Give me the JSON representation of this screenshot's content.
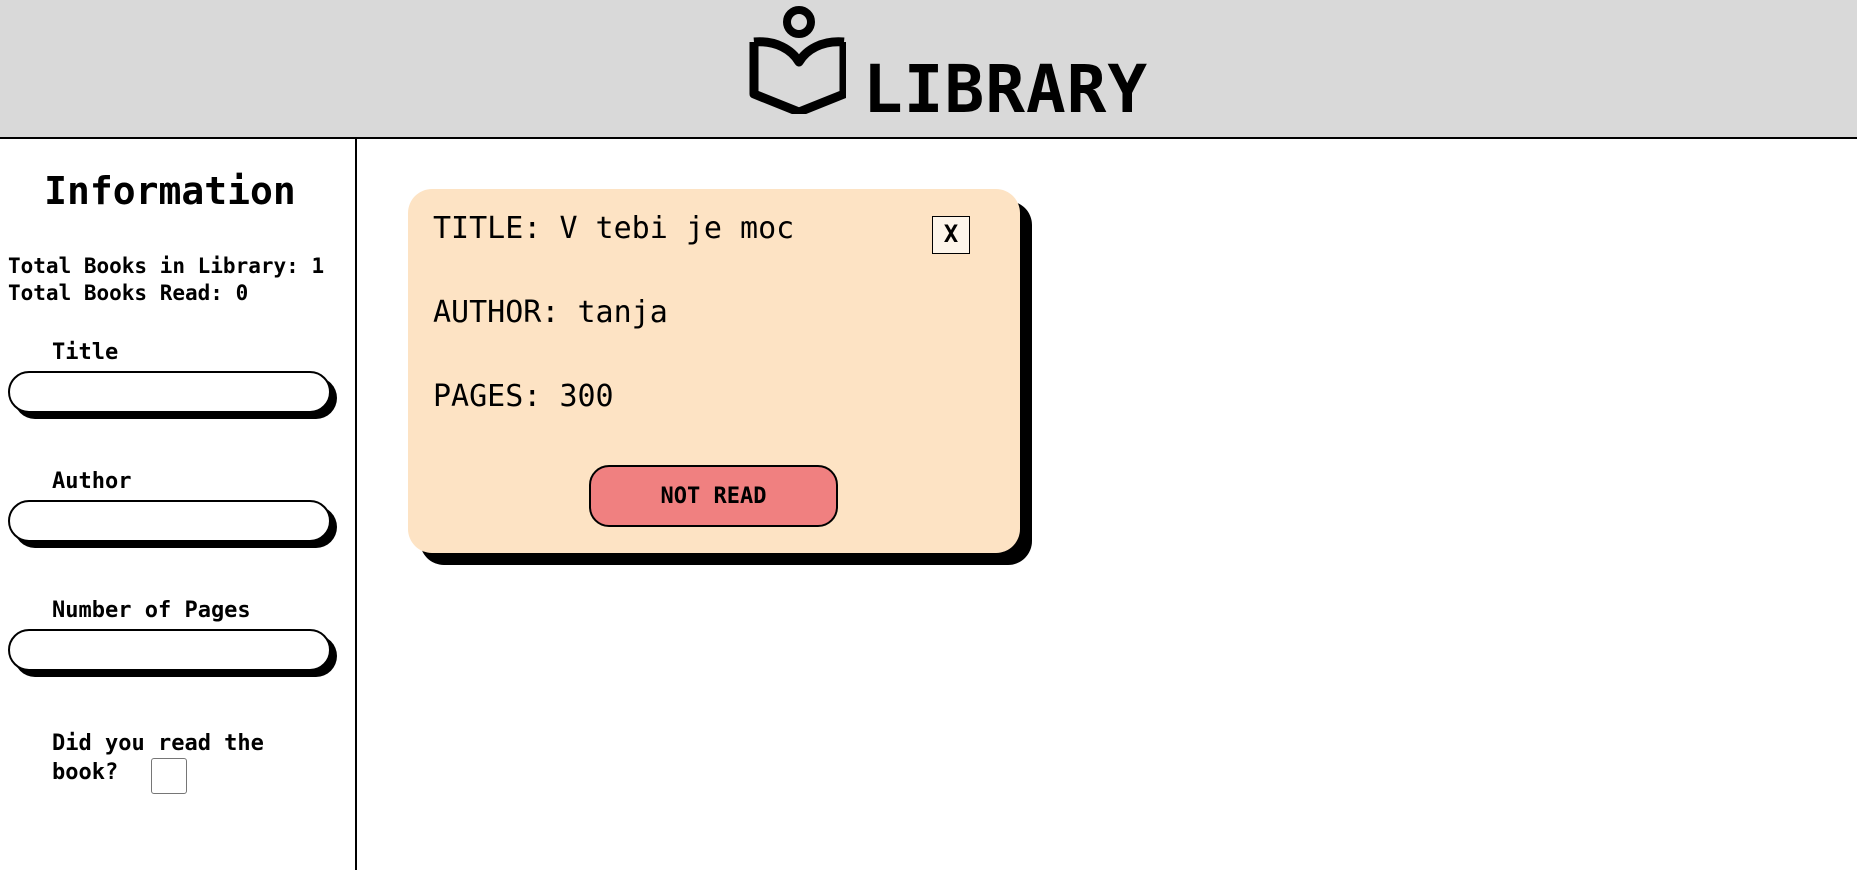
{
  "header": {
    "title": "LIBRARY",
    "logo_icon": "open-book-reader-icon"
  },
  "sidebar": {
    "title": "Information",
    "total_books_label": "Total Books in Library:",
    "total_books_value": "1",
    "total_read_label": "Total Books Read:",
    "total_read_value": "0",
    "form": {
      "title_label": "Title",
      "title_value": "",
      "author_label": "Author",
      "author_value": "",
      "pages_label": "Number of Pages",
      "pages_value": "",
      "read_question": "Did you read the book?",
      "read_checked": false
    }
  },
  "books": [
    {
      "title_label": "TITLE:",
      "title": "V tebi je moc",
      "author_label": "AUTHOR:",
      "author": "tanja",
      "pages_label": "PAGES:",
      "pages": "300",
      "remove_label": "X",
      "status_label": "NOT READ"
    }
  ],
  "colors": {
    "header_bg": "#d9d9d9",
    "card_bg": "#fde3c4",
    "not_read_button": "#f08080",
    "shadow": "#000000"
  }
}
